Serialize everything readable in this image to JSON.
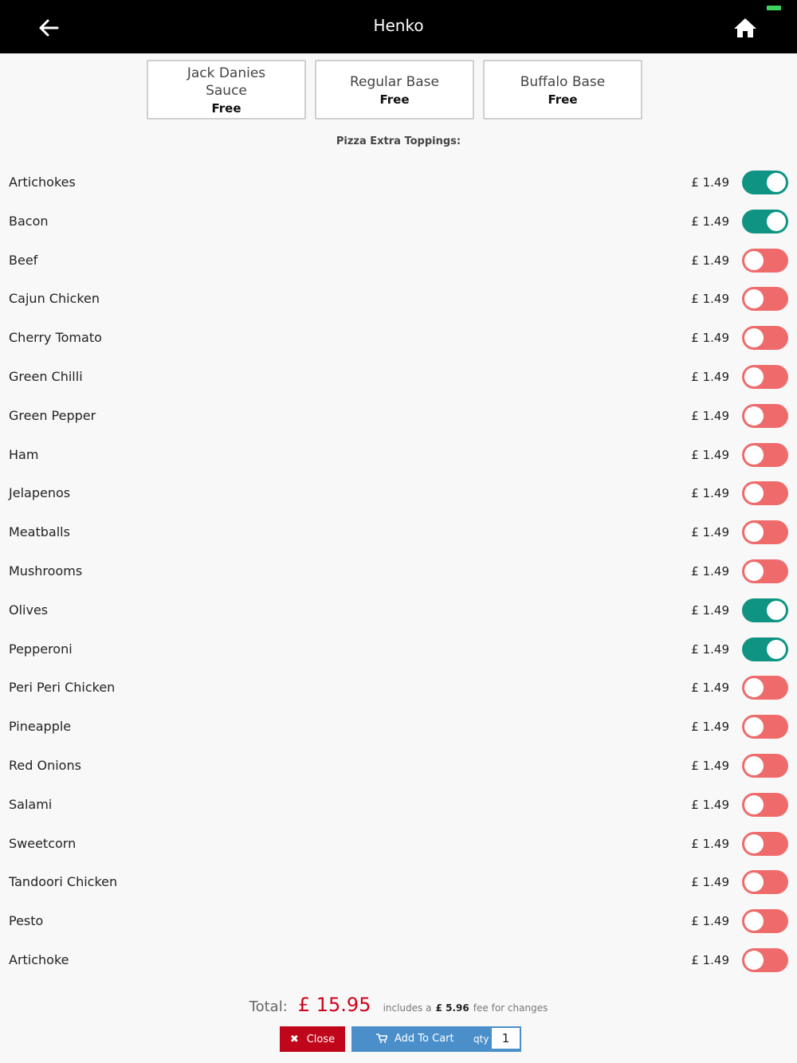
{
  "header": {
    "title": "Henko"
  },
  "base_options": [
    {
      "name": "Jack Danies Sauce",
      "price": "Free"
    },
    {
      "name": "Regular Base",
      "price": "Free"
    },
    {
      "name": "Buffalo Base",
      "price": "Free"
    }
  ],
  "section_title": "Pizza Extra Toppings:",
  "toppings": [
    {
      "name": "Artichokes",
      "price": "£ 1.49",
      "on": true
    },
    {
      "name": "Bacon",
      "price": "£ 1.49",
      "on": true
    },
    {
      "name": "Beef",
      "price": "£ 1.49",
      "on": false
    },
    {
      "name": "Cajun Chicken",
      "price": "£ 1.49",
      "on": false
    },
    {
      "name": "Cherry Tomato",
      "price": "£ 1.49",
      "on": false
    },
    {
      "name": "Green Chilli",
      "price": "£ 1.49",
      "on": false
    },
    {
      "name": "Green Pepper",
      "price": "£ 1.49",
      "on": false
    },
    {
      "name": "Ham",
      "price": "£ 1.49",
      "on": false
    },
    {
      "name": "Jelapenos",
      "price": "£ 1.49",
      "on": false
    },
    {
      "name": "Meatballs",
      "price": "£ 1.49",
      "on": false
    },
    {
      "name": "Mushrooms",
      "price": "£ 1.49",
      "on": false
    },
    {
      "name": "Olives",
      "price": "£ 1.49",
      "on": true
    },
    {
      "name": "Pepperoni",
      "price": "£ 1.49",
      "on": true
    },
    {
      "name": "Peri Peri Chicken",
      "price": "£ 1.49",
      "on": false
    },
    {
      "name": "Pineapple",
      "price": "£ 1.49",
      "on": false
    },
    {
      "name": "Red Onions",
      "price": "£ 1.49",
      "on": false
    },
    {
      "name": "Salami",
      "price": "£ 1.49",
      "on": false
    },
    {
      "name": "Sweetcorn",
      "price": "£ 1.49",
      "on": false
    },
    {
      "name": "Tandoori Chicken",
      "price": "£ 1.49",
      "on": false
    },
    {
      "name": "Pesto",
      "price": "£ 1.49",
      "on": false
    },
    {
      "name": "Artichoke",
      "price": "£ 1.49",
      "on": false
    }
  ],
  "footer": {
    "total_label": "Total:",
    "total_amount": "£ 15.95",
    "fee_prefix": "includes a",
    "fee_amount": "£ 5.96",
    "fee_suffix": "fee for changes",
    "close_label": "Close",
    "add_to_cart_label": "Add To Cart",
    "qty_label": "qty",
    "qty_value": "1"
  },
  "colors": {
    "toggle_on": "#0f9483",
    "toggle_off": "#ef6b6b",
    "total_red": "#d0021b",
    "close_red": "#c0061a",
    "cart_blue": "#4a8fca"
  }
}
